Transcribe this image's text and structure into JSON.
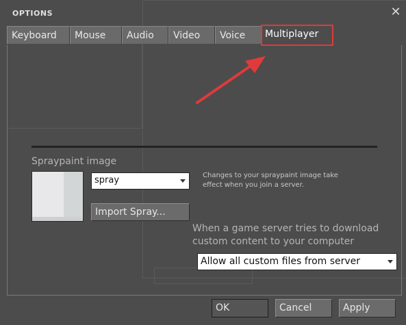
{
  "window": {
    "title": "OPTIONS"
  },
  "tabs": [
    {
      "label": "Keyboard"
    },
    {
      "label": "Mouse"
    },
    {
      "label": "Audio"
    },
    {
      "label": "Video"
    },
    {
      "label": "Voice"
    },
    {
      "label": "Multiplayer",
      "active": true
    }
  ],
  "spray": {
    "section_label": "Spraypaint image",
    "selected": "spray",
    "import_label": "Import Spray...",
    "hint_line1": "Changes to your spraypaint image take",
    "hint_line2": "effect when you join a server."
  },
  "download": {
    "prompt_line1": "When a game server tries to download",
    "prompt_line2": "custom content to your computer",
    "selected": "Allow all custom files from server"
  },
  "footer": {
    "ok_label": "OK",
    "cancel_label": "Cancel",
    "apply_label": "Apply"
  },
  "colors": {
    "annotation": "#e03a3a",
    "background": "#4c4c4c"
  },
  "icons": {
    "close": "close-icon",
    "dropdown": "chevron-down-icon"
  }
}
